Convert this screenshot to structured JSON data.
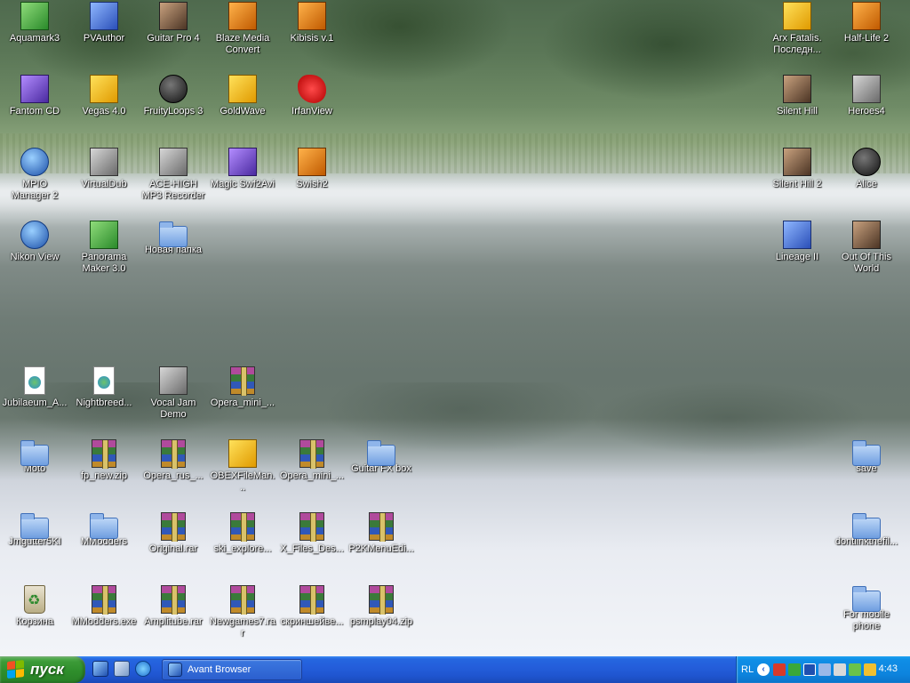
{
  "desktop": {
    "icons": [
      {
        "id": "aquamark3",
        "label": "Aquamark3",
        "art": "roundgreen"
      },
      {
        "id": "pvauthor",
        "label": "PVAuthor",
        "art": "sqblue"
      },
      {
        "id": "guitar-pro",
        "label": "Guitar Pro 4",
        "art": "sqphoto"
      },
      {
        "id": "blaze",
        "label": "Blaze Media Convert",
        "art": "sqorange"
      },
      {
        "id": "kibisis",
        "label": "Kibisis v.1",
        "art": "sqorange"
      },
      {
        "id": "arx",
        "label": "Arx Fatalis. Последн...",
        "art": "sqyellow"
      },
      {
        "id": "halflife",
        "label": "Half-Life 2",
        "art": "sqorange"
      },
      {
        "id": "fantom",
        "label": "Fantom CD",
        "art": "sqpurple"
      },
      {
        "id": "vegas",
        "label": "Vegas 4.0",
        "art": "sqyellow"
      },
      {
        "id": "fruity",
        "label": "FruityLoops 3",
        "art": "round-dark"
      },
      {
        "id": "goldwave",
        "label": "GoldWave",
        "art": "sqyellow"
      },
      {
        "id": "irfan",
        "label": "IrfanView",
        "art": "sqred"
      },
      {
        "id": "silenthill",
        "label": "Silent Hill",
        "art": "sqphoto"
      },
      {
        "id": "heroes4",
        "label": "Heroes4",
        "art": "sqgray"
      },
      {
        "id": "mpio",
        "label": "MPIO Manager 2",
        "art": "roundblue"
      },
      {
        "id": "vdub",
        "label": "VirtualDub",
        "art": "sqgray"
      },
      {
        "id": "acehigh",
        "label": "ACE-HIGH MP3 Recorder",
        "art": "sqgray"
      },
      {
        "id": "magicswf",
        "label": "Magic Swf2Avi",
        "art": "sqpurple"
      },
      {
        "id": "swish2",
        "label": "Swish2",
        "art": "sqorange"
      },
      {
        "id": "silenthill2",
        "label": "Silent Hill 2",
        "art": "sqphoto"
      },
      {
        "id": "alice",
        "label": "Alice",
        "art": "round-dark"
      },
      {
        "id": "nikon",
        "label": "Nikon View",
        "art": "roundblue"
      },
      {
        "id": "panorama",
        "label": "Panorama Maker 3.0",
        "art": "sqgreen"
      },
      {
        "id": "newfolder",
        "label": "Новая папка",
        "art": "folder"
      },
      {
        "id": "lineage",
        "label": "Lineage II",
        "art": "sqblue"
      },
      {
        "id": "ootw",
        "label": "Out Of This World",
        "art": "sqphoto"
      },
      {
        "id": "jubilaeum",
        "label": "Jubilaeum_A...",
        "art": "docpage"
      },
      {
        "id": "nightbreed",
        "label": "Nightbreed...",
        "art": "docpage"
      },
      {
        "id": "vocaljam",
        "label": "Vocal Jam Demo",
        "art": "sqgray"
      },
      {
        "id": "operamini1",
        "label": "Opera_mini_...",
        "art": "rar"
      },
      {
        "id": "moto",
        "label": "Moto",
        "art": "folder"
      },
      {
        "id": "fpnew",
        "label": "fp_new.zip",
        "art": "rar"
      },
      {
        "id": "operarus",
        "label": "Opera_rus_...",
        "art": "rar"
      },
      {
        "id": "obex",
        "label": "OBEXFileMan...",
        "art": "sqyellow"
      },
      {
        "id": "operamini2",
        "label": "Opera_mini_...",
        "art": "rar"
      },
      {
        "id": "guitarfx",
        "label": "Guitar FX box",
        "art": "folder"
      },
      {
        "id": "save",
        "label": "save",
        "art": "folder"
      },
      {
        "id": "jmgutter",
        "label": "Jmgutter5KI",
        "art": "folder"
      },
      {
        "id": "mmodders",
        "label": "MModders",
        "art": "folder"
      },
      {
        "id": "original",
        "label": "Original.rar",
        "art": "rar"
      },
      {
        "id": "skiexplore",
        "label": "ski_explore...",
        "art": "rar"
      },
      {
        "id": "xfiles",
        "label": "X_Files_Des...",
        "art": "rar"
      },
      {
        "id": "p2k",
        "label": "P2KMenuEdi...",
        "art": "rar"
      },
      {
        "id": "dontlink",
        "label": "dontlinkthefil...",
        "art": "folder"
      },
      {
        "id": "recycle",
        "label": "Корзина",
        "art": "recycle"
      },
      {
        "id": "mmoddersexe",
        "label": "MModders.exe",
        "art": "rar"
      },
      {
        "id": "amplitube",
        "label": "Amplitube.rar",
        "art": "rar"
      },
      {
        "id": "newgames",
        "label": "Newgames7.rar",
        "art": "rar"
      },
      {
        "id": "skrinsh",
        "label": "скриншейве...",
        "art": "rar"
      },
      {
        "id": "psmplay",
        "label": "psmplay04.zip",
        "art": "rar"
      },
      {
        "id": "formobile",
        "label": "For mobile phone",
        "art": "folder"
      }
    ]
  },
  "taskbar": {
    "start_label": "пуск",
    "tasks": [
      {
        "label": "Avant Browser"
      }
    ],
    "tray": {
      "lang": "RL",
      "clock": "4:43"
    }
  },
  "colors": {
    "taskbar_blue": "#245edb",
    "start_green": "#3c9b38",
    "tray_blue": "#0f8ee6"
  }
}
